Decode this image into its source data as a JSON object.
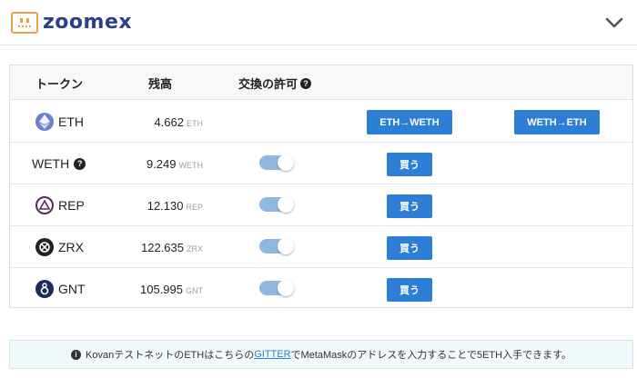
{
  "header": {
    "logo_text": "zoomex"
  },
  "table": {
    "headers": {
      "token": "トークン",
      "balance": "残高",
      "permission": "交換の許可"
    },
    "rows": [
      {
        "symbol": "ETH",
        "amount": "4.662",
        "unit": "ETH",
        "icon": "ethereum-icon"
      },
      {
        "symbol": "WETH",
        "amount": "9.249",
        "unit": "WETH",
        "icon": "help-icon",
        "toggle_on": true,
        "buy_label": "買う"
      },
      {
        "symbol": "REP",
        "amount": "12.130",
        "unit": "REP",
        "icon": "augur-icon",
        "toggle_on": true,
        "buy_label": "買う"
      },
      {
        "symbol": "ZRX",
        "amount": "122.635",
        "unit": "ZRX",
        "icon": "0x-icon",
        "toggle_on": true,
        "buy_label": "買う"
      },
      {
        "symbol": "GNT",
        "amount": "105.995",
        "unit": "GNT",
        "icon": "golem-icon",
        "toggle_on": true,
        "buy_label": "買う"
      }
    ],
    "eth_to_weth_label": "ETH→WETH",
    "weth_to_eth_label": "WETH→ETH"
  },
  "info": {
    "prefix": "KovanテストネットのETHはこちらの",
    "link": "GITTER",
    "suffix": "でMetaMaskのアドレスを入力することで5ETH入手できます。"
  },
  "colors": {
    "brand": "#2b3f8c",
    "accent": "#2c7fd4",
    "logo": "#e8a24a",
    "toggle": "#8fb8e0"
  }
}
